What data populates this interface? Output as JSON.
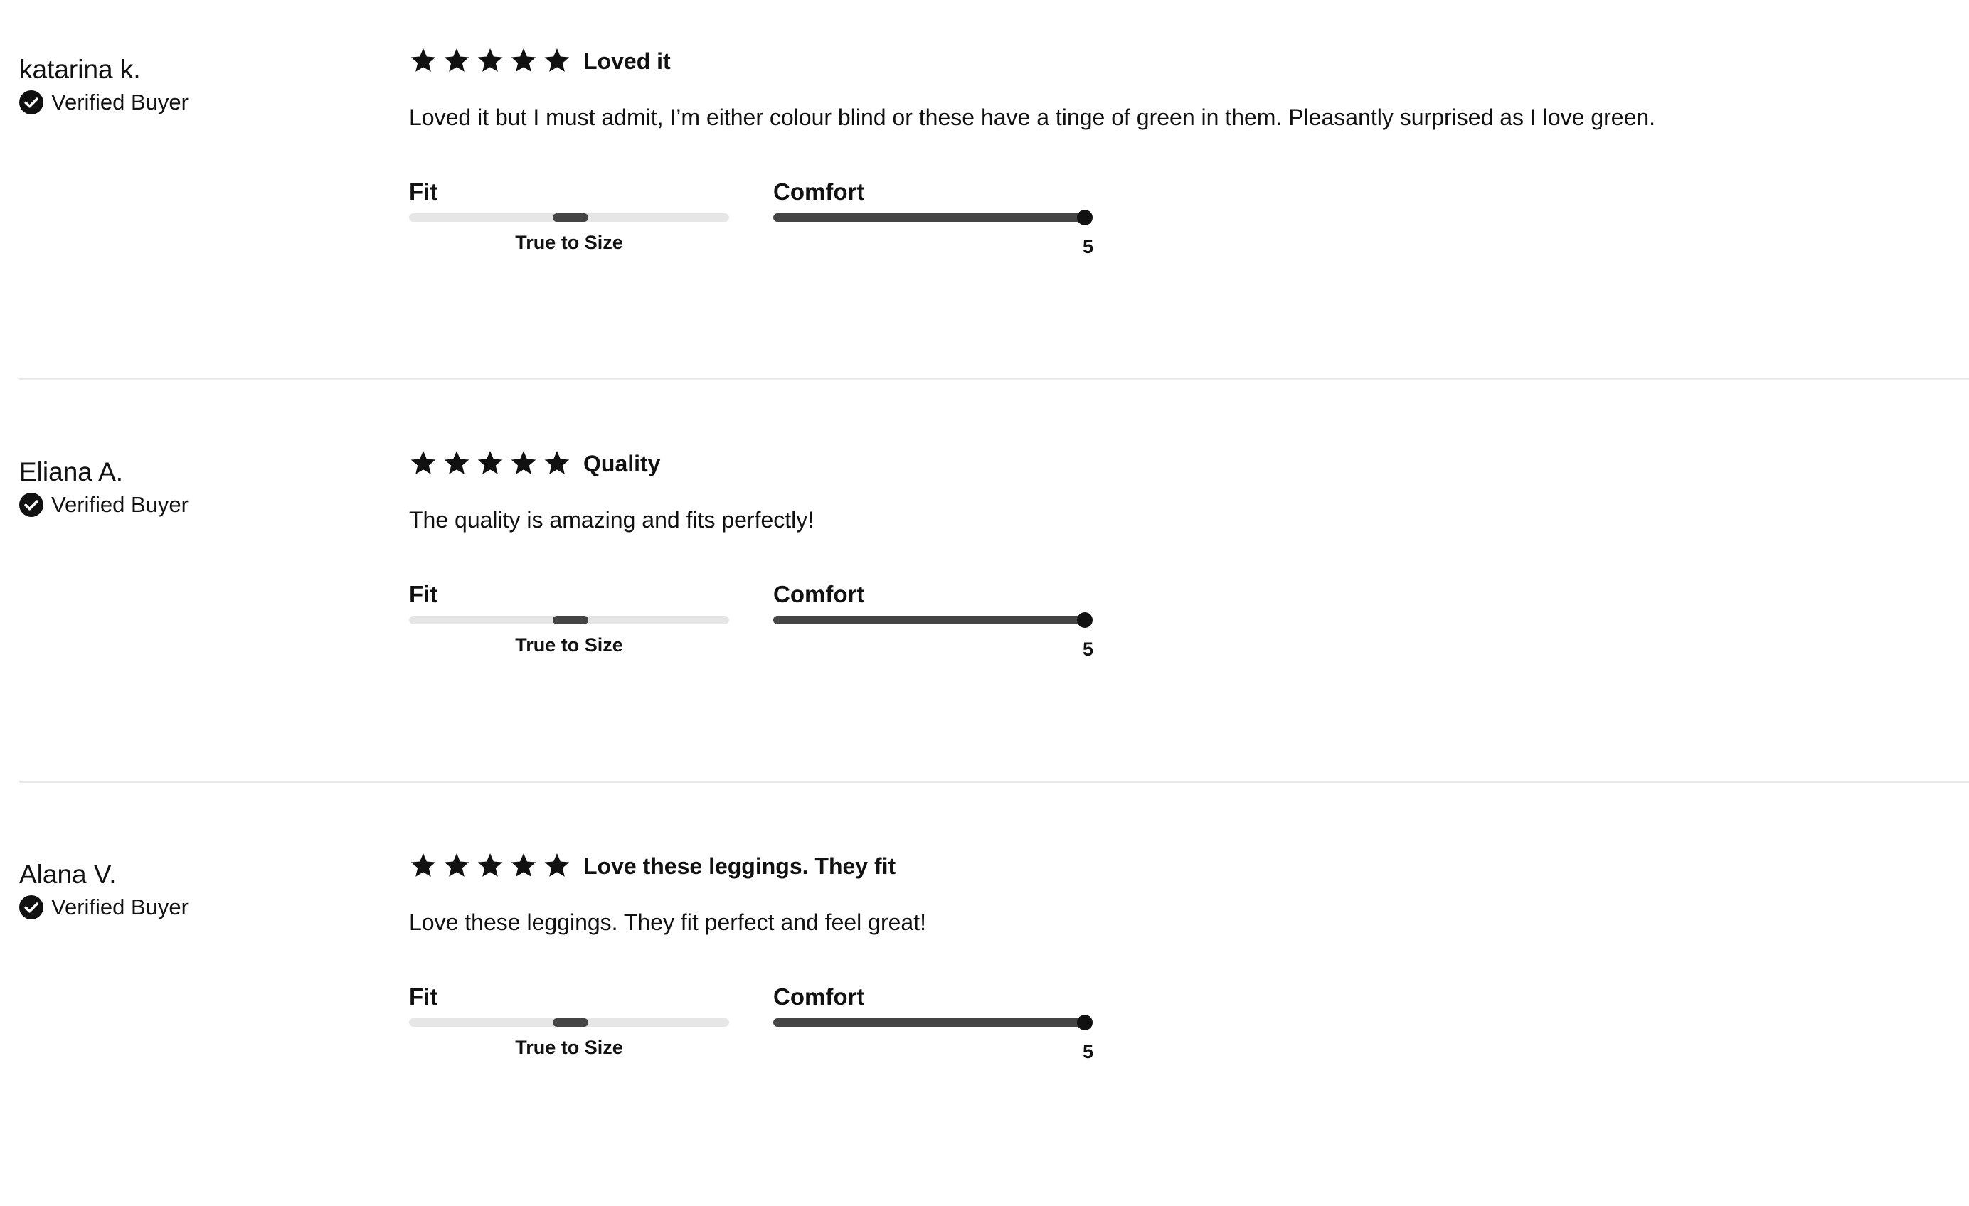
{
  "colors": {
    "text": "#111111",
    "track": "#e6e6e6",
    "fill": "#444444",
    "divider": "#e9e9e9"
  },
  "icons": {
    "star": "star-icon",
    "verified": "check-circle-icon"
  },
  "reviews": [
    {
      "name": "katarina k.",
      "verified_label": "Verified Buyer",
      "stars": 5,
      "title": "Loved it",
      "body": "Loved it but I must admit, I’m either colour blind or these have a tinge of green in them. Pleasantly surprised as I love green.",
      "fit": {
        "label": "Fit",
        "caption": "True to Size",
        "position": 0.5
      },
      "comfort": {
        "label": "Comfort",
        "value": "5",
        "max": 5
      }
    },
    {
      "name": "Eliana A.",
      "verified_label": "Verified Buyer",
      "stars": 5,
      "title": "Quality",
      "body": "The quality is amazing and fits perfectly!",
      "fit": {
        "label": "Fit",
        "caption": "True to Size",
        "position": 0.5
      },
      "comfort": {
        "label": "Comfort",
        "value": "5",
        "max": 5
      }
    },
    {
      "name": "Alana V.",
      "verified_label": "Verified Buyer",
      "stars": 5,
      "title": "Love these leggings. They fit",
      "body": "Love these leggings. They fit perfect and feel great!",
      "fit": {
        "label": "Fit",
        "caption": "True to Size",
        "position": 0.5
      },
      "comfort": {
        "label": "Comfort",
        "value": "5",
        "max": 5
      }
    }
  ]
}
